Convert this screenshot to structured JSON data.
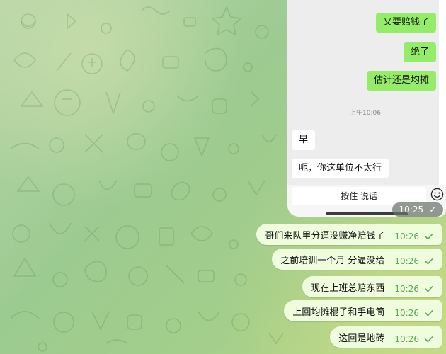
{
  "shot": {
    "bubbles_out": [
      "又要赔钱了",
      "绝了",
      "估计还是均摊"
    ],
    "timestamp": "上午10:06",
    "bubbles_in": [
      "早",
      "呃，你这单位不太行"
    ],
    "hold_to_talk": "按住 说话",
    "emoji_icon": "smiley-icon",
    "stamp_time": "10:25"
  },
  "messages": [
    {
      "text": "哥们来队里分逼没赚净赔钱了",
      "time": "10:26"
    },
    {
      "text": "之前培训一个月 分逼没给",
      "time": "10:26"
    },
    {
      "text": "现在上班总赔东西",
      "time": "10:26"
    },
    {
      "text": "上回均摊棍子和手电筒",
      "time": "10:26"
    },
    {
      "text": "这回是地砖",
      "time": "10:26"
    }
  ],
  "colors": {
    "outgoing_bubble": "#effdde",
    "time_green": "#5aa953",
    "wechat_green": "#95ec69"
  }
}
